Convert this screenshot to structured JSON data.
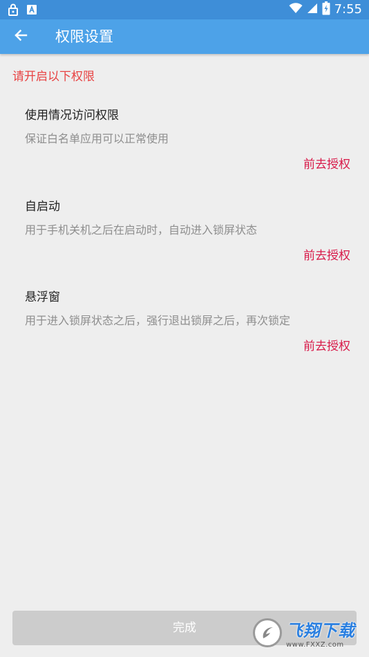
{
  "status_bar": {
    "time": "7:55",
    "icons": [
      "lock-icon",
      "keyboard-a-icon",
      "wifi-icon",
      "signal-icon",
      "battery-charging-icon"
    ]
  },
  "app_bar": {
    "title": "权限设置",
    "back_icon": "arrow-left-icon"
  },
  "notice": "请开启以下权限",
  "permissions": [
    {
      "title": "使用情况访问权限",
      "desc": "保证白名单应用可以正常使用",
      "action": "前去授权"
    },
    {
      "title": "自启动",
      "desc": "用于手机关机之后在启动时，自动进入锁屏状态",
      "action": "前去授权"
    },
    {
      "title": "悬浮窗",
      "desc": "用于进入锁屏状态之后，强行退出锁屏之后，再次锁定",
      "action": "前去授权"
    }
  ],
  "done_button": "完成",
  "watermark": {
    "name": "飞翔下载",
    "url": "www.FXXZ.com"
  },
  "colors": {
    "status_bar": "#3e8ed8",
    "app_bar": "#4da2e8",
    "notice": "#e84343",
    "action": "#d81b4a",
    "background": "#eeeeee"
  }
}
